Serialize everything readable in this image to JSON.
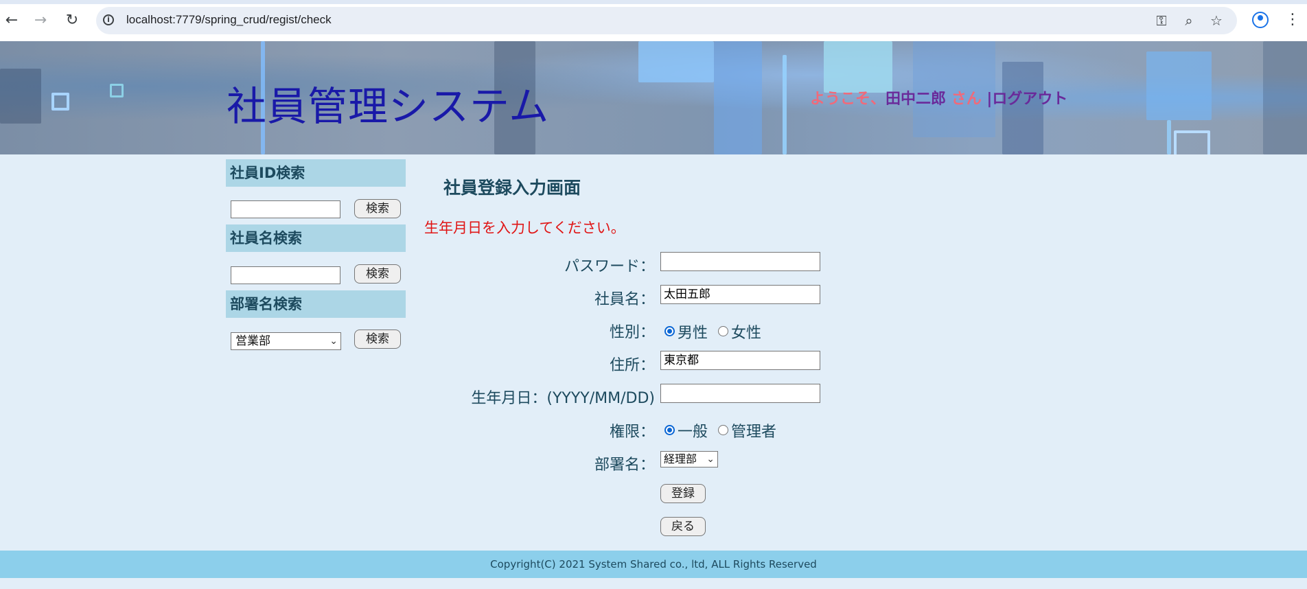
{
  "browser": {
    "url": "localhost:7779/spring_crud/regist/check",
    "icons": [
      "back-arrow-icon",
      "forward-arrow-icon",
      "reload-icon",
      "site-info-icon",
      "key-icon",
      "zoom-icon",
      "star-icon",
      "profile-icon",
      "menu-icon"
    ]
  },
  "header": {
    "title": "社員管理システム",
    "welcome_prefix": "ようこそ、",
    "user_name": "田中二郎",
    "welcome_suffix": " さん ",
    "separator": "|",
    "logout": "ログアウト"
  },
  "sidebar": {
    "id_search": {
      "heading": "社員ID検索",
      "value": "",
      "button": "検索"
    },
    "name_search": {
      "heading": "社員名検索",
      "value": "",
      "button": "検索"
    },
    "dept_search": {
      "heading": "部署名検索",
      "selected": "営業部",
      "button": "検索"
    }
  },
  "form": {
    "title": "社員登録入力画面",
    "error": "生年月日を入力してください。",
    "password": {
      "label": "パスワード：",
      "value": ""
    },
    "name": {
      "label": "社員名：",
      "value": "太田五郎"
    },
    "gender": {
      "label": "性別：",
      "options": [
        "男性",
        "女性"
      ],
      "selected": "男性"
    },
    "address": {
      "label": "住所：",
      "value": "東京都"
    },
    "birthday": {
      "label": "生年月日：(YYYY/MM/DD)",
      "value": ""
    },
    "role": {
      "label": "権限：",
      "options": [
        "一般",
        "管理者"
      ],
      "selected": "一般"
    },
    "department": {
      "label": "部署名：",
      "selected": "経理部"
    },
    "register_button": "登録",
    "back_button": "戻る"
  },
  "footer": {
    "copyright": "Copyright(C) 2021 System Shared co., ltd, ALL Rights Reserved"
  },
  "colors": {
    "title": "#1919a8",
    "error": "#e01414",
    "sidebar_head": "#acd6e6",
    "footer": "#8ccfeb",
    "background": "#e2eef8"
  }
}
